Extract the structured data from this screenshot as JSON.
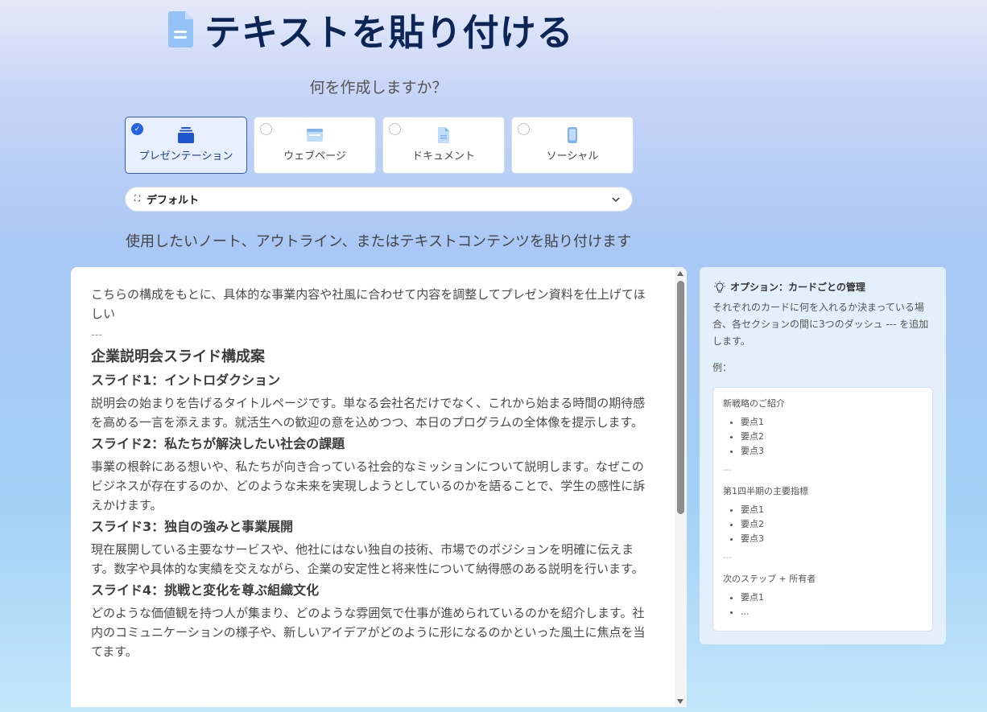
{
  "header": {
    "title": "テキストを貼り付ける",
    "subtitle": "何を作成しますか？"
  },
  "content_types": [
    {
      "label": "プレゼンテーション",
      "selected": true,
      "icon": "stack-cards-icon"
    },
    {
      "label": "ウェブページ",
      "selected": false,
      "icon": "browser-window-icon"
    },
    {
      "label": "ドキュメント",
      "selected": false,
      "icon": "document-icon"
    },
    {
      "label": "ソーシャル",
      "selected": false,
      "icon": "phone-icon"
    }
  ],
  "theme_select": {
    "value": "デフォルト"
  },
  "instruction": "使用したいノート、アウトライン、またはテキストコンテンツを貼り付けます",
  "editor": {
    "intro": "こちらの構成をもとに、具体的な事業内容や社風に合わせて内容を調整してプレゼン資料を仕上げてほしい",
    "separator": "---",
    "heading": "企業説明会スライド構成案",
    "slides": [
      {
        "title": "スライド1：イントロダクション",
        "body": "説明会の始まりを告げるタイトルページです。単なる会社名だけでなく、これから始まる時間の期待感を高める一言を添えます。就活生への歓迎の意を込めつつ、本日のプログラムの全体像を提示します。"
      },
      {
        "title": "スライド2：私たちが解決したい社会の課題",
        "body": "事業の根幹にある想いや、私たちが向き合っている社会的なミッションについて説明します。なぜこのビジネスが存在するのか、どのような未来を実現しようとしているのかを語ることで、学生の感性に訴えかけます。"
      },
      {
        "title": "スライド3：独自の強みと事業展開",
        "body": "現在展開している主要なサービスや、他社にはない独自の技術、市場でのポジションを明確に伝えます。数字や具体的な実績を交えながら、企業の安定性と将来性について納得感のある説明を行います。"
      },
      {
        "title": "スライド4：挑戦と変化を尊ぶ組織文化",
        "body": "どのような価値観を持つ人が集まり、どのような雰囲気で仕事が進められているのかを紹介します。社内のコミュニケーションの様子や、新しいアイデアがどのように形になるのかといった風土に焦点を当てます。"
      }
    ]
  },
  "tips": {
    "title": "オプション：カードごとの管理",
    "body": "それぞれのカードに何を入れるか決まっている場合、各セクションの間に3つのダッシュ --- を追加します。",
    "example_label": "例：",
    "example": {
      "sections": [
        {
          "heading": "新戦略のご紹介",
          "items": [
            "要点1",
            "要点2",
            "要点3"
          ]
        },
        {
          "heading": "第1四半期の主要指標",
          "items": [
            "要点1",
            "要点2",
            "要点3"
          ]
        },
        {
          "heading": "次のステップ + 所有者",
          "items": [
            "要点1",
            "..."
          ]
        }
      ],
      "separator": "---"
    }
  },
  "colors": {
    "accent": "#2562e4",
    "title": "#0b2557"
  }
}
